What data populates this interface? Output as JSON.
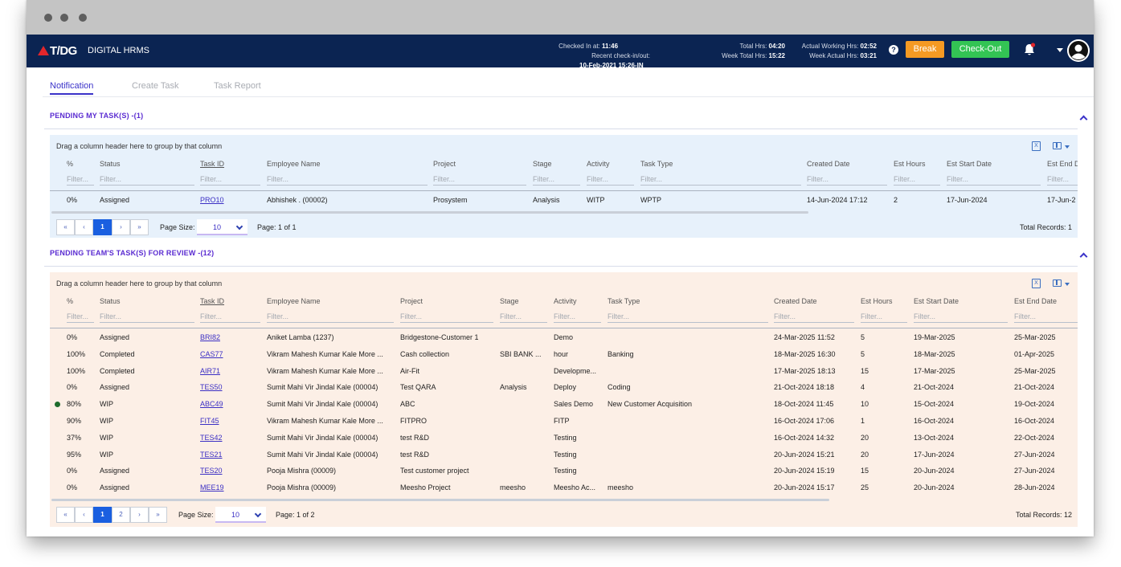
{
  "header": {
    "logo_text": "T/DG",
    "product": "DIGITAL HRMS",
    "checked_in_label": "Checked In at:",
    "checked_in_value": "11:46",
    "recent_label": "Recent check-in/out:",
    "recent_value": "10-Feb-2021 15:26-IN",
    "total_hrs_label": "Total Hrs:",
    "total_hrs_value": "04:20",
    "week_total_label": "Week Total Hrs:",
    "week_total_value": "15:22",
    "actual_working_label": "Actual Working Hrs:",
    "actual_working_value": "02:52",
    "week_actual_label": "Week Actual Hrs:",
    "week_actual_value": "03:21",
    "help_glyph": "?",
    "break_label": "Break",
    "checkout_label": "Check-Out"
  },
  "tabs": [
    {
      "label": "Notification",
      "active": true
    },
    {
      "label": "Create Task",
      "active": false
    },
    {
      "label": "Task Report",
      "active": false
    }
  ],
  "section1": {
    "title": "PENDING MY TASK(S) -(1)",
    "group_hint": "Drag a column header here to group by that column",
    "columns": [
      "%",
      "Status",
      "Task ID",
      "Employee Name",
      "Project",
      "Stage",
      "Activity",
      "Task Type",
      "Created Date",
      "Est Hours",
      "Est Start Date",
      "Est End D"
    ],
    "filter_placeholder": "Filter...",
    "rows": [
      [
        "0%",
        "Assigned",
        "PRO10",
        "Abhishek . (00002)",
        "Prosystem",
        "Analysis",
        "WITP",
        "WPTP",
        "14-Jun-2024 17:12",
        "2",
        "17-Jun-2024",
        "17-Jun-2"
      ]
    ],
    "pager": {
      "first": "«",
      "prev": "‹",
      "pages": [
        "1"
      ],
      "next": "›",
      "last": "»"
    },
    "page_size_label": "Page Size:",
    "page_size_value": "10",
    "page_info": "Page: 1 of 1",
    "total_records": "Total Records: 1"
  },
  "section2": {
    "title": "PENDING TEAM'S TASK(S) FOR REVIEW -(12)",
    "group_hint": "Drag a column header here to group by that column",
    "columns": [
      "%",
      "Status",
      "Task ID",
      "Employee Name",
      "Project",
      "Stage",
      "Activity",
      "Task Type",
      "Created Date",
      "Est Hours",
      "Est Start Date",
      "Est End Date"
    ],
    "filter_placeholder": "Filter...",
    "rows": [
      [
        "0%",
        "Assigned",
        "BRI82",
        "Aniket Lamba (1237)",
        "Bridgestone-Customer 1",
        "",
        "Demo",
        "",
        "24-Mar-2025 11:52",
        "5",
        "19-Mar-2025",
        "25-Mar-2025"
      ],
      [
        "100%",
        "Completed",
        "CAS77",
        "Vikram Mahesh Kumar Kale More ...",
        "Cash collection",
        "SBI BANK ...",
        "hour",
        "Banking",
        "18-Mar-2025 16:30",
        "5",
        "18-Mar-2025",
        "01-Apr-2025"
      ],
      [
        "100%",
        "Completed",
        "AIR71",
        "Vikram Mahesh Kumar Kale More ...",
        "Air-Fit",
        "",
        "Developme...",
        "",
        "17-Mar-2025 18:13",
        "15",
        "17-Mar-2025",
        "25-Mar-2025"
      ],
      [
        "0%",
        "Assigned",
        "TES50",
        "Sumit Mahi Vir Jindal Kale (00004)",
        "Test QARA",
        "Analysis",
        "Deploy",
        "Coding",
        "21-Oct-2024 18:18",
        "4",
        "21-Oct-2024",
        "21-Oct-2024"
      ],
      [
        "80%",
        "WIP",
        "ABC49",
        "Sumit Mahi Vir Jindal Kale (00004)",
        "ABC",
        "",
        "Sales Demo",
        "New Customer Acquisition",
        "18-Oct-2024 11:45",
        "10",
        "15-Oct-2024",
        "19-Oct-2024"
      ],
      [
        "90%",
        "WIP",
        "FIT45",
        "Vikram Mahesh Kumar Kale More ...",
        "FITPRO",
        "",
        "FITP",
        "",
        "16-Oct-2024 17:06",
        "1",
        "16-Oct-2024",
        "16-Oct-2024"
      ],
      [
        "37%",
        "WIP",
        "TES42",
        "Sumit Mahi Vir Jindal Kale (00004)",
        "test R&D",
        "",
        "Testing",
        "",
        "16-Oct-2024 14:32",
        "20",
        "13-Oct-2024",
        "22-Oct-2024"
      ],
      [
        "95%",
        "WIP",
        "TES21",
        "Sumit Mahi Vir Jindal Kale (00004)",
        "test R&D",
        "",
        "Testing",
        "",
        "20-Jun-2024 15:21",
        "20",
        "17-Jun-2024",
        "27-Jun-2024"
      ],
      [
        "0%",
        "Assigned",
        "TES20",
        "Pooja Mishra (00009)",
        "Test customer project",
        "",
        "Testing",
        "",
        "20-Jun-2024 15:19",
        "15",
        "20-Jun-2024",
        "27-Jun-2024"
      ],
      [
        "0%",
        "Assigned",
        "MEE19",
        "Pooja Mishra (00009)",
        "Meesho Project",
        "meesho",
        "Meesho Ac...",
        "meesho",
        "20-Jun-2024 15:17",
        "25",
        "20-Jun-2024",
        "28-Jun-2024"
      ]
    ],
    "pager": {
      "first": "«",
      "prev": "‹",
      "pages": [
        "1",
        "2"
      ],
      "next": "›",
      "last": "»"
    },
    "page_size_label": "Page Size:",
    "page_size_value": "10",
    "page_info": "Page: 1 of 2",
    "total_records": "Total Records: 12"
  },
  "colors": {
    "nav_bg": "#0b2452",
    "accent": "#3b33c9",
    "break": "#f59a23",
    "checkout": "#33c454",
    "grid1_bg": "#e7f1fb",
    "grid2_bg": "#fcefe6",
    "wip_marker": "#1e6b2c"
  },
  "icons": [
    "help-icon",
    "bell-icon",
    "caret-down-icon",
    "avatar",
    "chevron-up-icon",
    "excel-export-icon",
    "columns-icon"
  ]
}
